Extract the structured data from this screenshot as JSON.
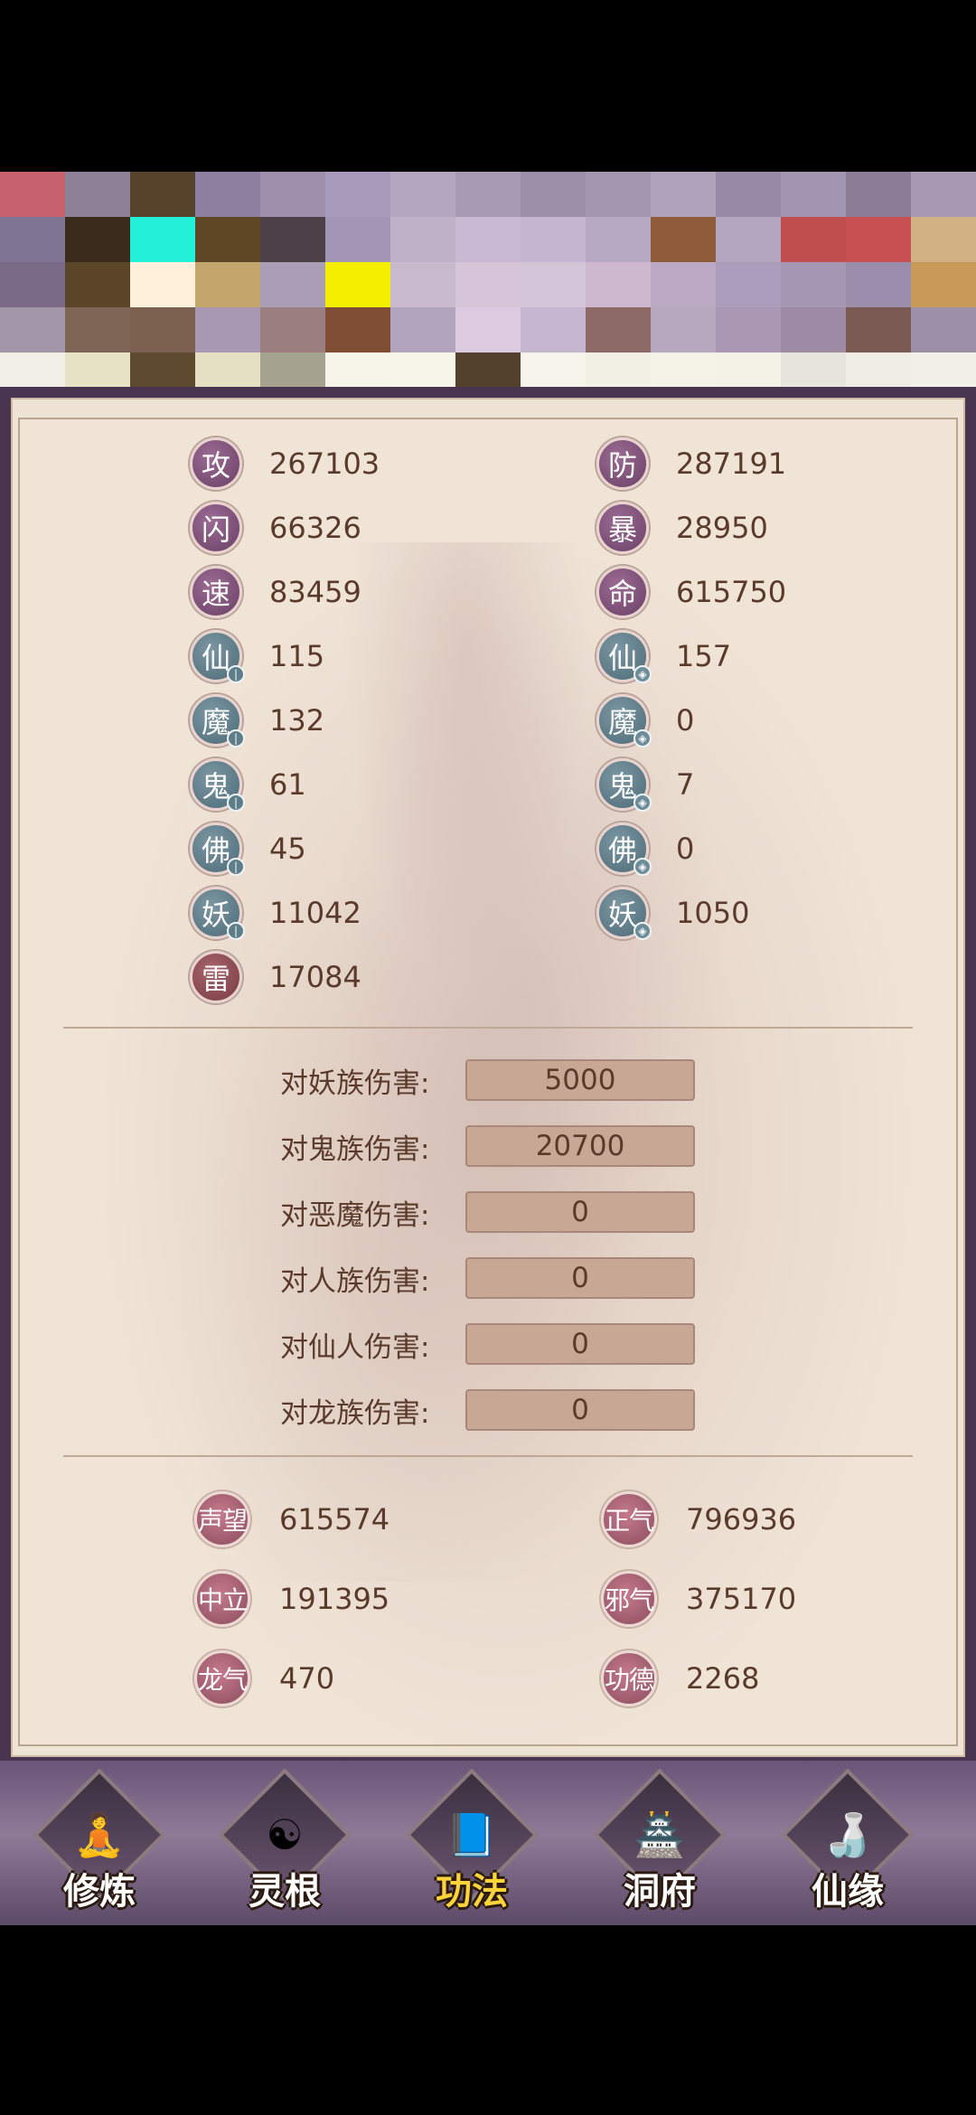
{
  "stats_left": [
    {
      "char": "攻",
      "value": "267103",
      "style": "purple"
    },
    {
      "char": "闪",
      "value": "66326",
      "style": "purple"
    },
    {
      "char": "速",
      "value": "83459",
      "style": "purple"
    },
    {
      "char": "仙",
      "value": "115",
      "style": "teal",
      "mini": "attack"
    },
    {
      "char": "魔",
      "value": "132",
      "style": "teal",
      "mini": "attack"
    },
    {
      "char": "鬼",
      "value": "61",
      "style": "teal",
      "mini": "attack"
    },
    {
      "char": "佛",
      "value": "45",
      "style": "teal",
      "mini": "attack"
    },
    {
      "char": "妖",
      "value": "11042",
      "style": "teal",
      "mini": "attack"
    },
    {
      "char": "雷",
      "value": "17084",
      "style": "red"
    }
  ],
  "stats_right": [
    {
      "char": "防",
      "value": "287191",
      "style": "purple"
    },
    {
      "char": "暴",
      "value": "28950",
      "style": "purple"
    },
    {
      "char": "命",
      "value": "615750",
      "style": "purple"
    },
    {
      "char": "仙",
      "value": "157",
      "style": "teal",
      "mini": "shield"
    },
    {
      "char": "魔",
      "value": "0",
      "style": "teal",
      "mini": "shield"
    },
    {
      "char": "鬼",
      "value": "7",
      "style": "teal",
      "mini": "shield"
    },
    {
      "char": "佛",
      "value": "0",
      "style": "teal",
      "mini": "shield"
    },
    {
      "char": "妖",
      "value": "1050",
      "style": "teal",
      "mini": "shield"
    }
  ],
  "damage": [
    {
      "label": "对妖族伤害:",
      "value": "5000"
    },
    {
      "label": "对鬼族伤害:",
      "value": "20700"
    },
    {
      "label": "对恶魔伤害:",
      "value": "0"
    },
    {
      "label": "对人族伤害:",
      "value": "0"
    },
    {
      "label": "对仙人伤害:",
      "value": "0"
    },
    {
      "label": "对龙族伤害:",
      "value": "0"
    }
  ],
  "reputation_left": [
    {
      "label": "声望",
      "value": "615574"
    },
    {
      "label": "中立",
      "value": "191395"
    },
    {
      "label": "龙气",
      "value": "470"
    }
  ],
  "reputation_right": [
    {
      "label": "正气",
      "value": "796936"
    },
    {
      "label": "邪气",
      "value": "375170"
    },
    {
      "label": "功德",
      "value": "2268"
    }
  ],
  "nav": [
    {
      "label": "修炼",
      "icon": "monk-icon",
      "glyph": "🧘",
      "active": false
    },
    {
      "label": "灵根",
      "icon": "yin-yang-sword-icon",
      "glyph": "☯",
      "active": false
    },
    {
      "label": "功法",
      "icon": "book-icon",
      "glyph": "📘",
      "active": true
    },
    {
      "label": "洞府",
      "icon": "pagoda-icon",
      "glyph": "🏯",
      "active": false
    },
    {
      "label": "仙缘",
      "icon": "gourd-icon",
      "glyph": "🍶",
      "active": false
    }
  ],
  "colors": {
    "panel_bg": "#f0e4d7",
    "text": "#5a3a2a",
    "active_nav": "#ffd43a"
  }
}
